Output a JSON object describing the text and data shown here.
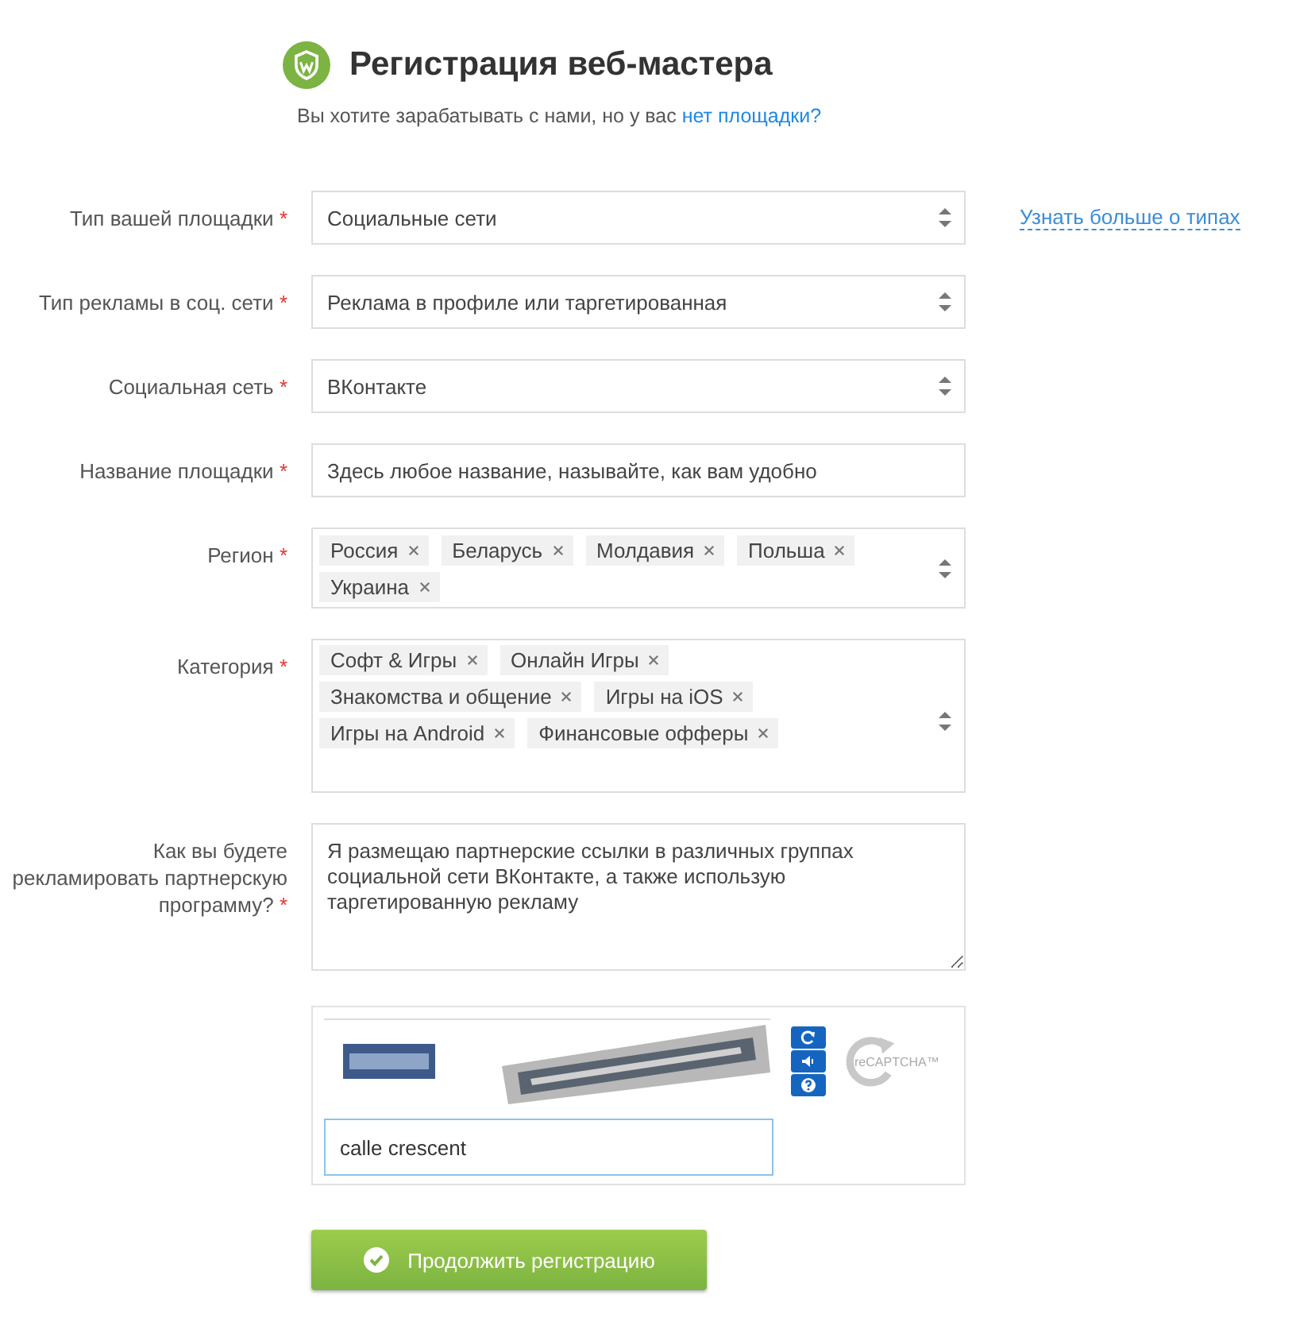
{
  "header": {
    "title": "Регистрация веб-мастера",
    "subtitle": "Вы хотите зарабатывать с нами, но у вас",
    "subtitle_link": "нет площадки?"
  },
  "fields": [
    {
      "kind": "select",
      "label": "Тип вашей площадки",
      "required_mark": "*",
      "value": "Социальные сети",
      "aside_link": "Узнать больше о типах"
    },
    {
      "kind": "select",
      "label": "Тип рекламы в соц. сети",
      "required_mark": "*",
      "value": "Реклама в профиле или таргетированная"
    },
    {
      "kind": "select",
      "label": "Социальная сеть",
      "required_mark": "*",
      "value": "ВКонтакте"
    },
    {
      "kind": "text",
      "label": "Название площадки",
      "required_mark": "*",
      "value": "Здесь любое название, называйте, как вам удобно"
    },
    {
      "kind": "tags",
      "label": "Регион",
      "required_mark": "*",
      "tags": [
        "Россия",
        "Беларусь",
        "Молдавия",
        "Польша",
        "Украина"
      ]
    },
    {
      "kind": "tags",
      "label": "Категория",
      "required_mark": "*",
      "tags": [
        "Софт & Игры",
        "Онлайн Игры",
        "Знакомства и общение",
        "Игры на iOS",
        "Игры на Android",
        "Финансовые офферы"
      ]
    },
    {
      "kind": "textarea",
      "label": "Как вы будете рекламировать партнерскую программу?",
      "required_mark": "*",
      "value": "Я размещаю партнерские ссылки в различных группах социальной сети ВКонтакте, а также использую таргетированную рекламу"
    }
  ],
  "captcha": {
    "answer": "calle crescent",
    "logo": "reCAPTCHA™"
  },
  "submit_button": "Продолжить регистрацию"
}
